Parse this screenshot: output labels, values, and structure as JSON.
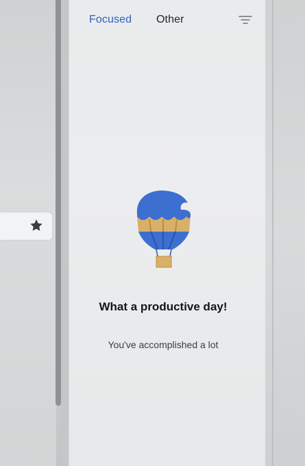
{
  "tabs": {
    "focused_label": "Focused",
    "other_label": "Other",
    "active": "Focused"
  },
  "icons": {
    "filter": "filter-icon",
    "star": "star-icon",
    "illustration": "hot-air-balloon-icon"
  },
  "empty_state": {
    "title": "What a productive day!",
    "subtitle": "You've accomplished a lot"
  },
  "colors": {
    "accent": "#2c63b9",
    "balloon_blue": "#3d6fd0",
    "balloon_tan": "#d8b06a"
  }
}
